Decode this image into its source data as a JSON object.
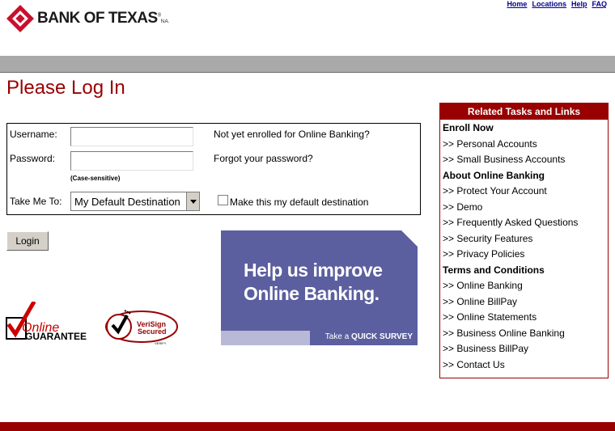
{
  "brand": {
    "name": "BANK OF TEXAS",
    "suffix": "N.A.",
    "mark": "®"
  },
  "top_links": [
    "Home",
    "Locations",
    "Help",
    "FAQ"
  ],
  "page_title": "Please Log In",
  "login": {
    "username_label": "Username:",
    "password_label": "Password:",
    "case_note": "(Case-sensitive)",
    "take_me_to_label": "Take Me To:",
    "destination_value": "My Default Destination",
    "enroll_link": "Not yet enrolled for Online Banking?",
    "forgot_link": "Forgot your password?",
    "default_dest_label": "Make this my default destination",
    "login_button": "Login"
  },
  "badges": {
    "online": "Online",
    "guarantee": "GUARANTEE",
    "verisign_1": "VeriSign",
    "verisign_2": "Secured",
    "verify": "VERIFY"
  },
  "survey": {
    "line1": "Help us improve",
    "line2": "Online Banking.",
    "cta_prefix": "Take a",
    "cta": "QUICK SURVEY"
  },
  "related": {
    "title": "Related Tasks and Links",
    "enroll_head": "Enroll Now",
    "enroll_items": [
      ">> Personal Accounts",
      ">> Small Business Accounts"
    ],
    "about_head": "About Online Banking",
    "about_items": [
      ">> Protect Your Account",
      ">> Demo",
      ">> Frequently Asked Questions",
      ">> Security Features",
      ">> Privacy Policies"
    ],
    "terms_head": "Terms and Conditions",
    "terms_items": [
      ">> Online Banking",
      ">> Online BillPay",
      ">> Online Statements",
      ">> Business Online Banking",
      ">> Business BillPay",
      ">> Contact Us"
    ]
  },
  "colors": {
    "brand_red": "#990000",
    "link_blue": "#00008b",
    "survey_purple": "#5b5f9f",
    "bar_grey": "#a9a9a9"
  }
}
